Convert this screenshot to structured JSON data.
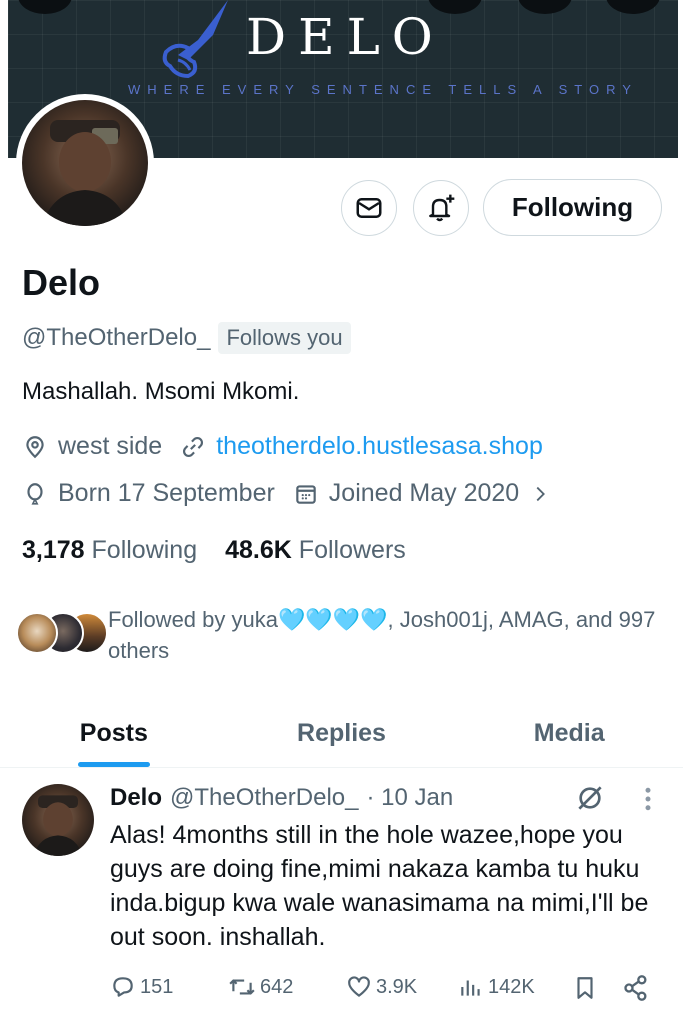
{
  "banner": {
    "title": "DELO",
    "tagline": "WHERE EVERY SENTENCE TELLS A STORY"
  },
  "profile": {
    "name": "Delo",
    "handle": "@TheOtherDelo_",
    "follows_you": "Follows you",
    "bio": "Mashallah. Msomi Mkomi.",
    "location": "west side",
    "website": "theotherdelo.hustlesasa.shop",
    "born": "Born 17 September",
    "joined": "Joined May 2020",
    "following_count": "3,178",
    "following_label": "Following",
    "followers_count": "48.6K",
    "followers_label": "Followers",
    "followed_by_text": "Followed by yuka🩵🩵🩵🩵, Josh001j, AMAG, and 997 others"
  },
  "actions": {
    "following_button": "Following"
  },
  "tabs": [
    {
      "label": "Posts",
      "active": true
    },
    {
      "label": "Replies",
      "active": false
    },
    {
      "label": "Media",
      "active": false
    }
  ],
  "post": {
    "author": "Delo",
    "handle": "@TheOtherDelo_",
    "date": "· 10 Jan",
    "text": "Alas! 4months still in the hole wazee,hope you guys are doing fine,mimi nakaza kamba tu huku inda.bigup kwa wale wanasimama na mimi,I'll be out soon. inshallah.",
    "replies": "151",
    "reposts": "642",
    "likes": "3.9K",
    "views": "142K"
  },
  "colors": {
    "accent": "#1d9bf0",
    "banner_bg": "#1f2d33",
    "tagline": "#5b74c9",
    "secondary_text": "#536471"
  }
}
